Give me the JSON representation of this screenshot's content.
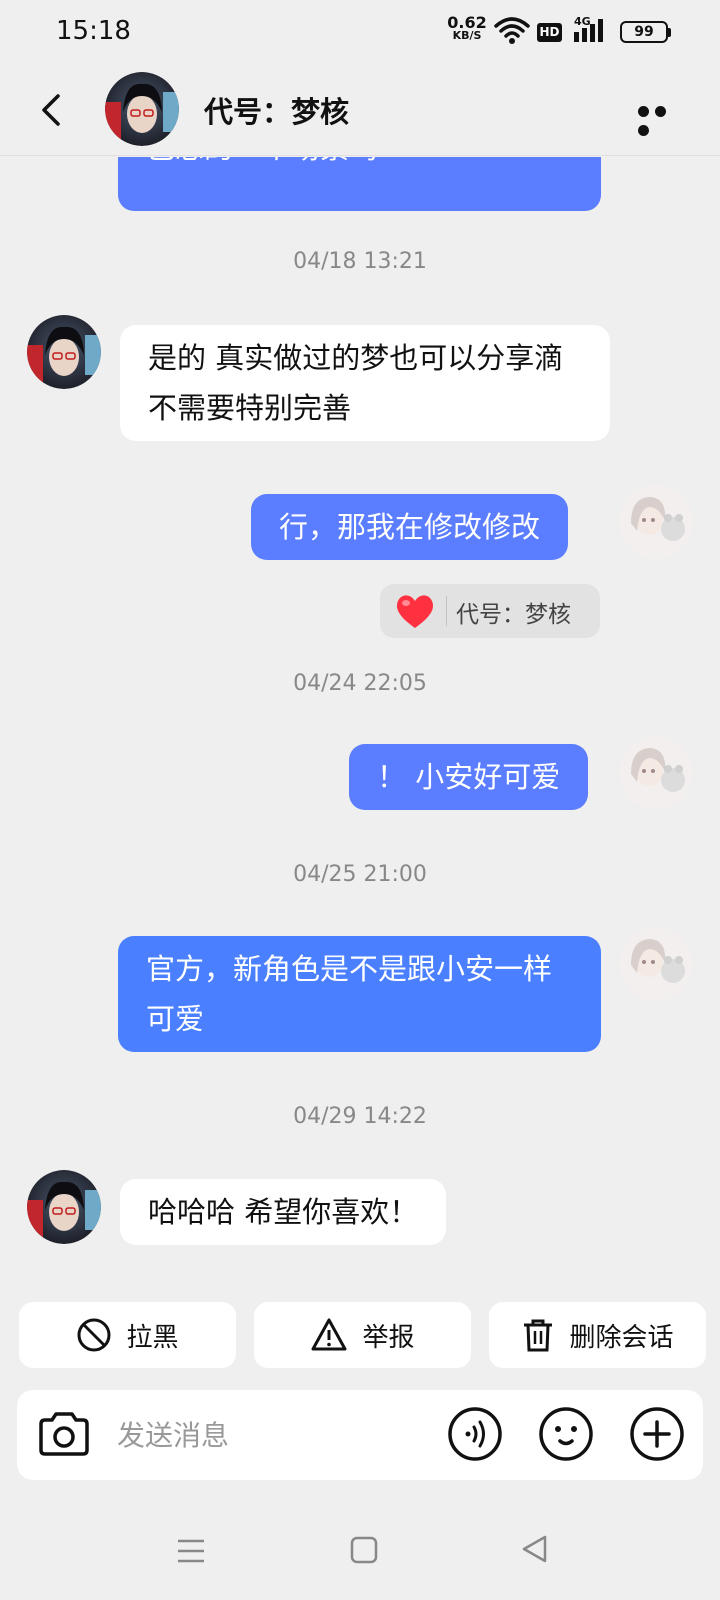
{
  "status_bar": {
    "time": "15:18",
    "net_speed_value": "0.62",
    "net_speed_unit": "KB/S",
    "hd_label": "HD",
    "network_label": "4G",
    "battery": "99"
  },
  "header": {
    "title": "代号：梦核"
  },
  "messages": {
    "m0": "己想的一个场景吗",
    "ts1": "04/18 13:21",
    "m1": "是的 真实做过的梦也可以分享滴 不需要特别完善",
    "m2": "行，那我在修改修改",
    "reaction_name": "代号：梦核",
    "ts2": "04/24 22:05",
    "m3": "！ 小安好可爱",
    "ts3": "04/25 21:00",
    "m4": "官方，新角色是不是跟小安一样可爱",
    "ts4": "04/29 14:22",
    "m5": "哈哈哈 希望你喜欢！"
  },
  "actions": {
    "block": "拉黑",
    "report": "举报",
    "delete": "删除会话"
  },
  "input": {
    "placeholder": "发送消息"
  },
  "colors": {
    "outgoing_bubble": "#5b7dff",
    "incoming_bubble": "#ffffff",
    "background": "#efefef",
    "heart": "#ff3040"
  }
}
